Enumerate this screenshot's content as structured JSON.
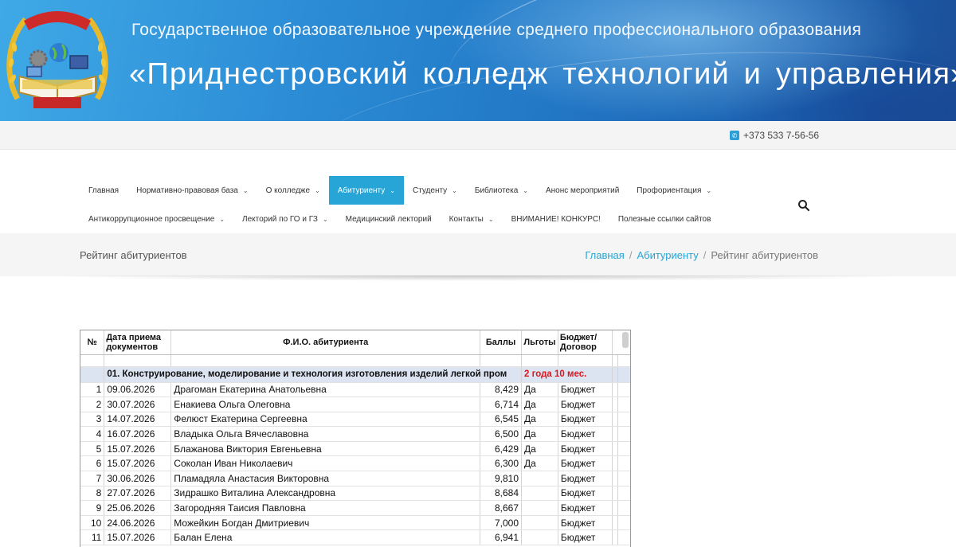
{
  "banner": {
    "line1": "Государственное образовательное учреждение среднего профессионального образования",
    "line2": "«Приднестровский колледж технологий и управления»"
  },
  "topbar": {
    "phone": "+373 533 7-56-56"
  },
  "nav": {
    "row1": [
      {
        "label": "Главная",
        "caret": false,
        "active": false
      },
      {
        "label": "Нормативно-правовая база",
        "caret": true,
        "active": false
      },
      {
        "label": "О колледже",
        "caret": true,
        "active": false
      },
      {
        "label": "Абитуриенту",
        "caret": true,
        "active": true
      },
      {
        "label": "Студенту",
        "caret": true,
        "active": false
      },
      {
        "label": "Библиотека",
        "caret": true,
        "active": false
      },
      {
        "label": "Анонс мероприятий",
        "caret": false,
        "active": false
      },
      {
        "label": "Профориентация",
        "caret": true,
        "active": false
      }
    ],
    "row2": [
      {
        "label": "Антикоррупционное просвещение",
        "caret": true,
        "active": false
      },
      {
        "label": "Лекторий по ГО и ГЗ",
        "caret": true,
        "active": false
      },
      {
        "label": "Медицинский лекторий",
        "caret": false,
        "active": false
      },
      {
        "label": "Контакты",
        "caret": true,
        "active": false
      },
      {
        "label": "ВНИМАНИЕ! КОНКУРС!",
        "caret": false,
        "active": false
      },
      {
        "label": "Полезные ссылки сайтов",
        "caret": false,
        "active": false
      }
    ],
    "search_icon": "search-icon",
    "accent_color": "#26a5d6"
  },
  "page": {
    "title": "Рейтинг абитуриентов",
    "breadcrumb": {
      "home": "Главная",
      "parent": "Абитуриенту",
      "current": "Рейтинг абитуриентов",
      "sep": "/"
    }
  },
  "table": {
    "headers": {
      "num": "№",
      "date": "Дата приема документов",
      "name": "Ф.И.О. абитуриента",
      "score": "Баллы",
      "benefit": "Льготы",
      "budget": "Бюджет/ Договор"
    },
    "section": {
      "title": "01. Конструирование, моделирование и технология изготовления изделий легкой пром",
      "duration": "2 года 10 мес."
    },
    "rows": [
      {
        "n": "1",
        "date": "09.06.2026",
        "name": "Драгоман Екатерина Анатольевна",
        "score": "8,429",
        "benefit": "Да",
        "budget": "Бюджет"
      },
      {
        "n": "2",
        "date": "30.07.2026",
        "name": "Енакиева Ольга Олеговна",
        "score": "6,714",
        "benefit": "Да",
        "budget": "Бюджет"
      },
      {
        "n": "3",
        "date": "14.07.2026",
        "name": "Фелюст Екатерина Сергеевна",
        "score": "6,545",
        "benefit": "Да",
        "budget": "Бюджет"
      },
      {
        "n": "4",
        "date": "16.07.2026",
        "name": "Владыка Ольга Вячеславовна",
        "score": "6,500",
        "benefit": "Да",
        "budget": "Бюджет"
      },
      {
        "n": "5",
        "date": "15.07.2026",
        "name": "Блажанова Виктория Евгеньевна",
        "score": "6,429",
        "benefit": "Да",
        "budget": "Бюджет"
      },
      {
        "n": "6",
        "date": "15.07.2026",
        "name": "Соколан Иван Николаевич",
        "score": "6,300",
        "benefit": "Да",
        "budget": "Бюджет"
      },
      {
        "n": "7",
        "date": "30.06.2026",
        "name": "Пламадяла Анастасия Викторовна",
        "score": "9,810",
        "benefit": "",
        "budget": "Бюджет"
      },
      {
        "n": "8",
        "date": "27.07.2026",
        "name": "Зидрашко Виталина Александровна",
        "score": "8,684",
        "benefit": "",
        "budget": "Бюджет"
      },
      {
        "n": "9",
        "date": "25.06.2026",
        "name": "Загородняя Таисия Павловна",
        "score": "8,667",
        "benefit": "",
        "budget": "Бюджет"
      },
      {
        "n": "10",
        "date": "24.06.2026",
        "name": "Можейкин Богдан Дмитриевич",
        "score": "7,000",
        "benefit": "",
        "budget": "Бюджет"
      },
      {
        "n": "11",
        "date": "15.07.2026",
        "name": "Балан Елена",
        "score": "6,941",
        "benefit": "",
        "budget": "Бюджет"
      }
    ]
  }
}
